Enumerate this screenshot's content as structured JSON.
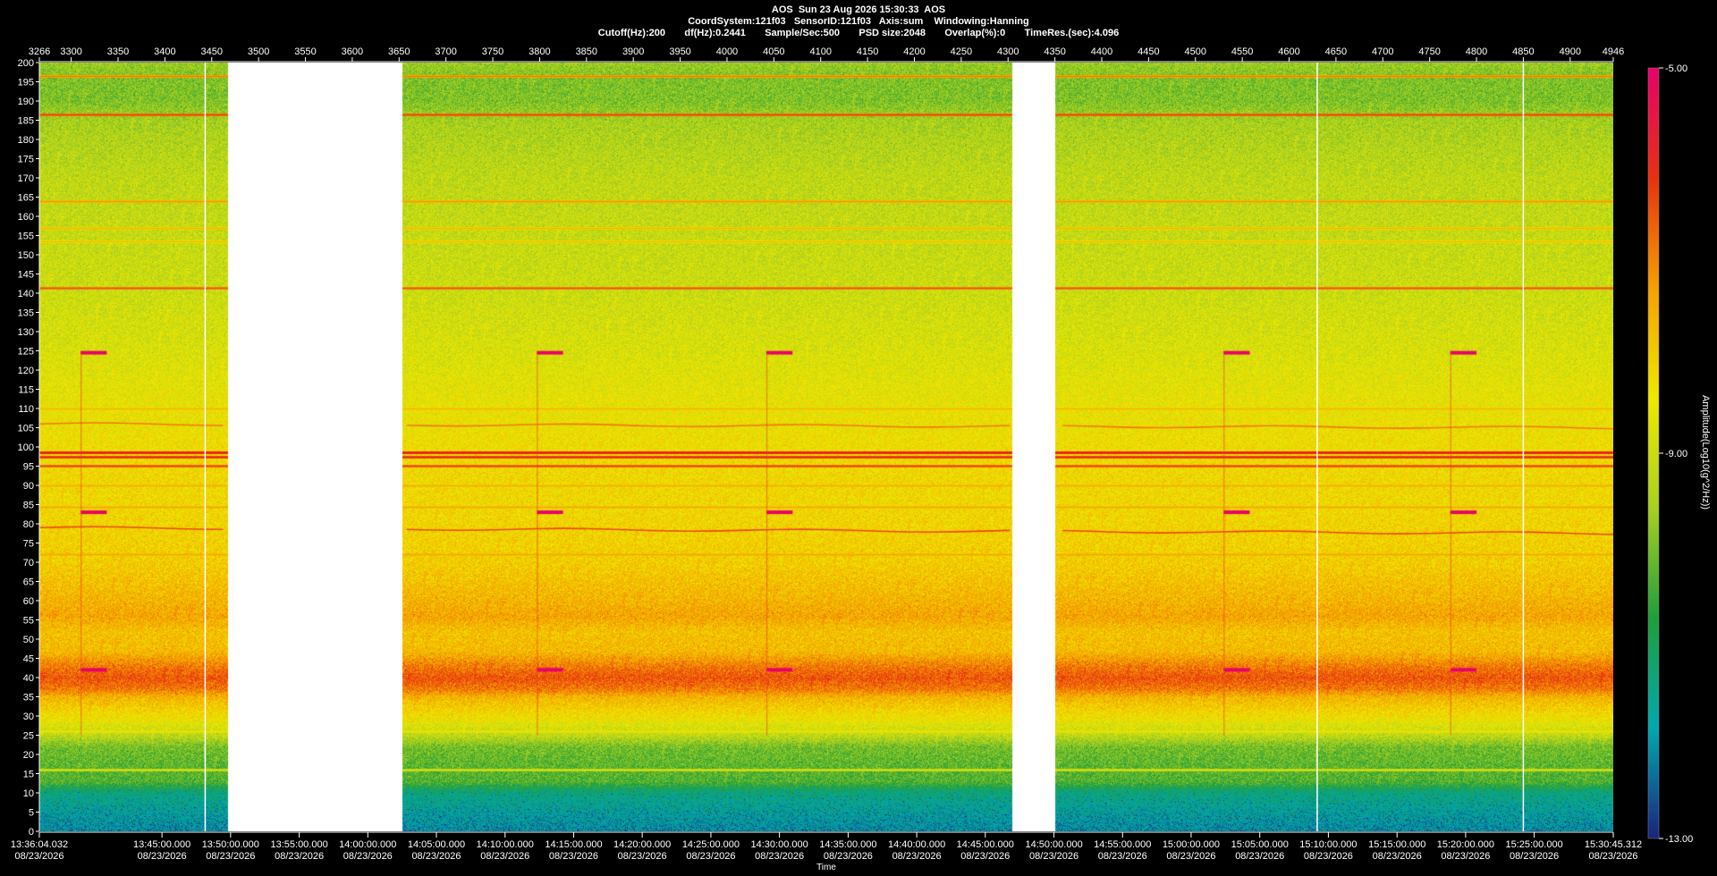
{
  "header": {
    "line1": "AOS  Sun 23 Aug 2026 15:30:33  AOS",
    "line2": "CoordSystem:121f03   SensorID:121f03   Axis:sum    Windowing:Hanning",
    "line3": "Cutoff(Hz):200       df(Hz):0.2441       Sample/Sec:500       PSD size:2048       Overlap(%):0       TimeRes.(sec):4.096"
  },
  "chart_data": {
    "type": "heatmap",
    "title": "",
    "xlabel": "Time",
    "ylabel": "",
    "colorbar_label": "Amplitude(Log10(g^2/Hz))",
    "colorbar_range": [
      -13.0,
      -5.0
    ],
    "colorbar_ticks": [
      "-5.00",
      "-9.00",
      "-13.00"
    ],
    "colormap": [
      "#1a237e",
      "#00a8b0",
      "#1f9e3a",
      "#a8d020",
      "#f0e800",
      "#f5a000",
      "#e83010",
      "#e8006a"
    ],
    "ylim": [
      0,
      200
    ],
    "y_ticks": [
      0,
      5,
      10,
      15,
      20,
      25,
      30,
      35,
      40,
      45,
      50,
      55,
      60,
      65,
      70,
      75,
      80,
      85,
      90,
      95,
      100,
      105,
      110,
      115,
      120,
      125,
      130,
      135,
      140,
      145,
      150,
      155,
      160,
      165,
      170,
      175,
      180,
      185,
      190,
      195,
      200
    ],
    "top_axis_range": [
      3266,
      4946
    ],
    "top_axis_ticks": [
      3266,
      3300,
      3350,
      3400,
      3450,
      3500,
      3550,
      3600,
      3650,
      3700,
      3750,
      3800,
      3850,
      3900,
      3950,
      4000,
      4050,
      4100,
      4150,
      4200,
      4250,
      4300,
      4350,
      4400,
      4450,
      4500,
      4550,
      4600,
      4650,
      4700,
      4750,
      4800,
      4850,
      4900,
      4946
    ],
    "time_ticks": [
      {
        "time": "13:36:04.032",
        "date": "08/23/2026",
        "pos": 3266
      },
      {
        "time": "13:45:00.000",
        "date": "08/23/2026",
        "pos": 3396.9
      },
      {
        "time": "13:50:00.000",
        "date": "08/23/2026",
        "pos": 3470.1
      },
      {
        "time": "13:55:00.000",
        "date": "08/23/2026",
        "pos": 3543.4
      },
      {
        "time": "14:00:00.000",
        "date": "08/23/2026",
        "pos": 3616.6
      },
      {
        "time": "14:05:00.000",
        "date": "08/23/2026",
        "pos": 3689.8
      },
      {
        "time": "14:10:00.000",
        "date": "08/23/2026",
        "pos": 3763.1
      },
      {
        "time": "14:15:00.000",
        "date": "08/23/2026",
        "pos": 3836.3
      },
      {
        "time": "14:20:00.000",
        "date": "08/23/2026",
        "pos": 3909.5
      },
      {
        "time": "14:25:00.000",
        "date": "08/23/2026",
        "pos": 3982.8
      },
      {
        "time": "14:30:00.000",
        "date": "08/23/2026",
        "pos": 4056
      },
      {
        "time": "14:35:00.000",
        "date": "08/23/2026",
        "pos": 4129.3
      },
      {
        "time": "14:40:00.000",
        "date": "08/23/2026",
        "pos": 4202.5
      },
      {
        "time": "14:45:00.000",
        "date": "08/23/2026",
        "pos": 4275.7
      },
      {
        "time": "14:50:00.000",
        "date": "08/23/2026",
        "pos": 4349
      },
      {
        "time": "14:55:00.000",
        "date": "08/23/2026",
        "pos": 4422.2
      },
      {
        "time": "15:00:00.000",
        "date": "08/23/2026",
        "pos": 4495.4
      },
      {
        "time": "15:05:00.000",
        "date": "08/23/2026",
        "pos": 4568.7
      },
      {
        "time": "15:10:00.000",
        "date": "08/23/2026",
        "pos": 4641.9
      },
      {
        "time": "15:15:00.000",
        "date": "08/23/2026",
        "pos": 4715.2
      },
      {
        "time": "15:20:00.000",
        "date": "08/23/2026",
        "pos": 4788.4
      },
      {
        "time": "15:25:00.000",
        "date": "08/23/2026",
        "pos": 4861.6
      },
      {
        "time": "15:30:45.312",
        "date": "08/23/2026",
        "pos": 4946
      }
    ],
    "data_gaps": [
      [
        3467,
        3653
      ],
      [
        4304,
        4350
      ]
    ],
    "marker_lines_x": [
      3443,
      4630,
      4850
    ],
    "spectral_lines": [
      {
        "freq": 98.5,
        "level": -5.6
      },
      {
        "freq": 97.5,
        "level": -5.9
      },
      {
        "freq": 95.2,
        "level": -6.3
      },
      {
        "freq": 186.5,
        "level": -6.3
      },
      {
        "freq": 141.5,
        "level": -6.5
      },
      {
        "freq": 196.5,
        "level": -6.9
      },
      {
        "freq": 164.0,
        "level": -7.2
      },
      {
        "freq": 157.0,
        "level": -7.6
      },
      {
        "freq": 153.5,
        "level": -7.7
      },
      {
        "freq": 110.0,
        "level": -7.6
      },
      {
        "freq": 90.0,
        "level": -7.5
      },
      {
        "freq": 84.5,
        "level": -7.4
      },
      {
        "freq": 72.0,
        "level": -7.4
      },
      {
        "freq": 26.0,
        "level": -8.3
      },
      {
        "freq": 16.0,
        "level": -8.8
      }
    ],
    "drifting_lines": [
      {
        "freqs_start": 106,
        "freqs_end": 105,
        "level": -6.9
      },
      {
        "freqs_start": 79,
        "freqs_end": 77.5,
        "level": -6.4
      }
    ],
    "transient_events_x": [
      3310,
      3797,
      4042,
      4530,
      4772
    ],
    "transient_bands": [
      124.5,
      83.0,
      42.0
    ],
    "background_profile": [
      {
        "freq": 0,
        "level": -12.0
      },
      {
        "freq": 5,
        "level": -11.7
      },
      {
        "freq": 10,
        "level": -11.3
      },
      {
        "freq": 13,
        "level": -10.3
      },
      {
        "freq": 17,
        "level": -10.2
      },
      {
        "freq": 22,
        "level": -10.0
      },
      {
        "freq": 25,
        "level": -9.2
      },
      {
        "freq": 30,
        "level": -8.3
      },
      {
        "freq": 35,
        "level": -7.6
      },
      {
        "freq": 37,
        "level": -6.9
      },
      {
        "freq": 40,
        "level": -6.5
      },
      {
        "freq": 43,
        "level": -6.9
      },
      {
        "freq": 47,
        "level": -7.7
      },
      {
        "freq": 52,
        "level": -7.8
      },
      {
        "freq": 56,
        "level": -7.4
      },
      {
        "freq": 60,
        "level": -7.6
      },
      {
        "freq": 70,
        "level": -8.0
      },
      {
        "freq": 85,
        "level": -8.2
      },
      {
        "freq": 95,
        "level": -8.2
      },
      {
        "freq": 105,
        "level": -8.4
      },
      {
        "freq": 115,
        "level": -8.6
      },
      {
        "freq": 125,
        "level": -8.8
      },
      {
        "freq": 140,
        "level": -9.0
      },
      {
        "freq": 155,
        "level": -9.1
      },
      {
        "freq": 170,
        "level": -9.2
      },
      {
        "freq": 185,
        "level": -9.5
      },
      {
        "freq": 190,
        "level": -9.9
      },
      {
        "freq": 196,
        "level": -9.9
      },
      {
        "freq": 200,
        "level": -9.6
      }
    ]
  }
}
